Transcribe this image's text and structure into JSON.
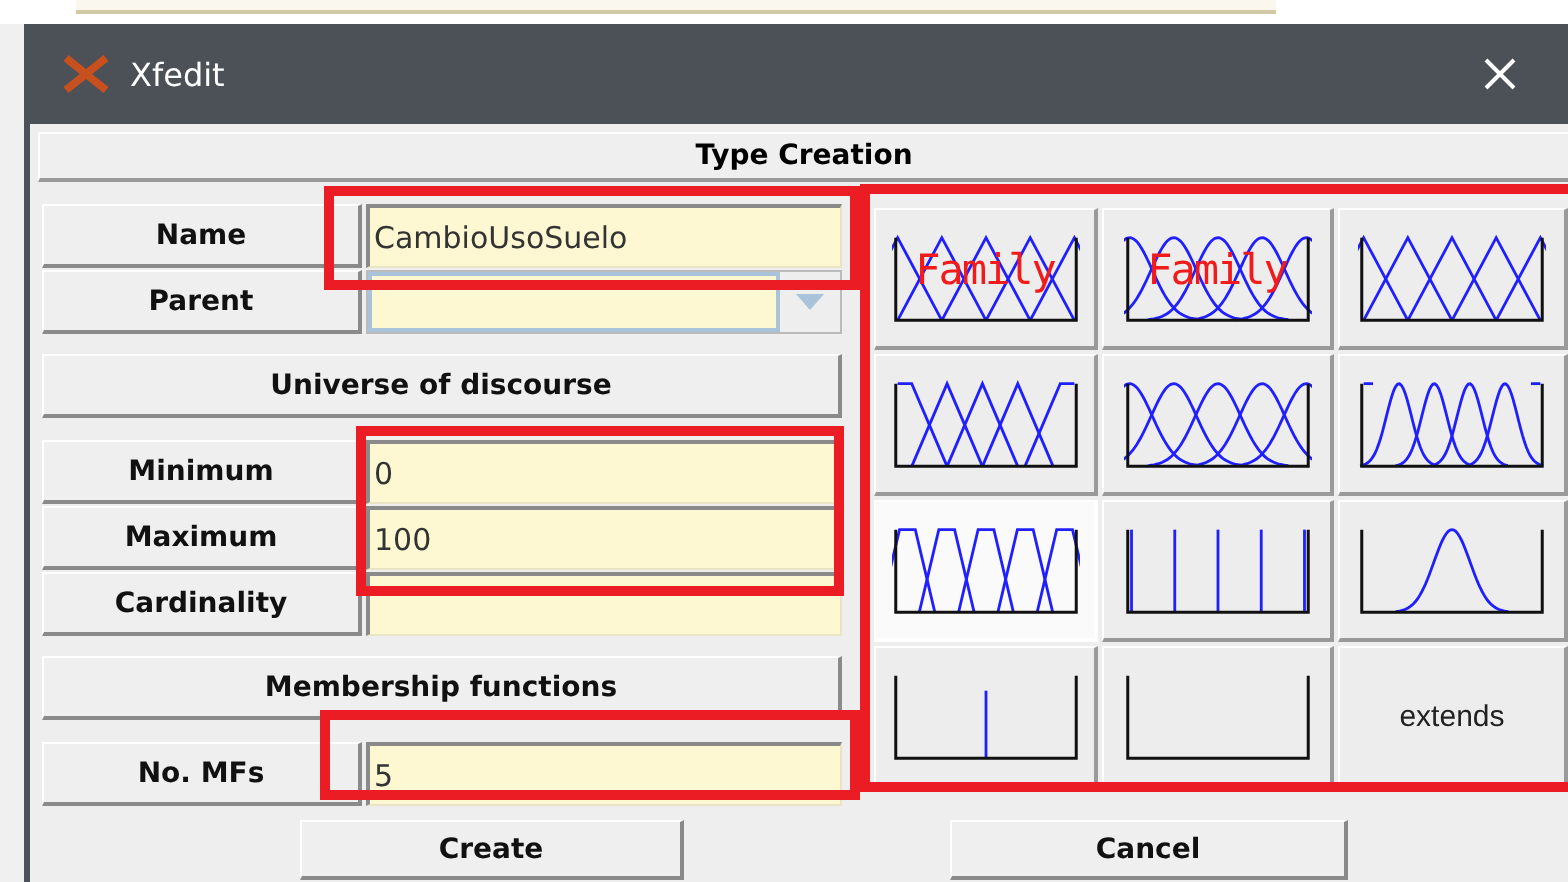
{
  "window": {
    "title": "Xfedit"
  },
  "header": "Type Creation",
  "form": [
    {
      "kind": "field",
      "label": "Name",
      "value": "CambioUsoSuelo"
    },
    {
      "kind": "combo",
      "label": "Parent",
      "disabled": true
    },
    {
      "kind": "section",
      "label": "Universe of discourse"
    },
    {
      "kind": "field",
      "label": "Minimum",
      "value": "0"
    },
    {
      "kind": "field",
      "label": "Maximum",
      "value": "100"
    },
    {
      "kind": "field",
      "label": "Cardinality"
    },
    {
      "kind": "section",
      "label": "Membership functions"
    },
    {
      "kind": "field",
      "label": "No. MFs",
      "value": "5"
    }
  ],
  "families": [
    {
      "kind": "triangle",
      "label": "Family",
      "selected": false
    },
    {
      "kind": "bell",
      "label": "Family",
      "selected": false
    },
    {
      "kind": "triangle",
      "selected": false
    },
    {
      "kind": "shoulder",
      "selected": false
    },
    {
      "kind": "bell",
      "selected": false
    },
    {
      "kind": "smooth",
      "selected": false
    },
    {
      "kind": "trapezoid",
      "selected": true
    },
    {
      "kind": "singleton",
      "selected": false
    },
    {
      "kind": "gauss",
      "selected": false
    },
    {
      "kind": "impulse",
      "selected": false
    },
    {
      "kind": "empty",
      "selected": false
    },
    {
      "kind": "extends",
      "label": "extends",
      "selected": false
    }
  ],
  "buttons": [
    "Create",
    "Cancel"
  ]
}
